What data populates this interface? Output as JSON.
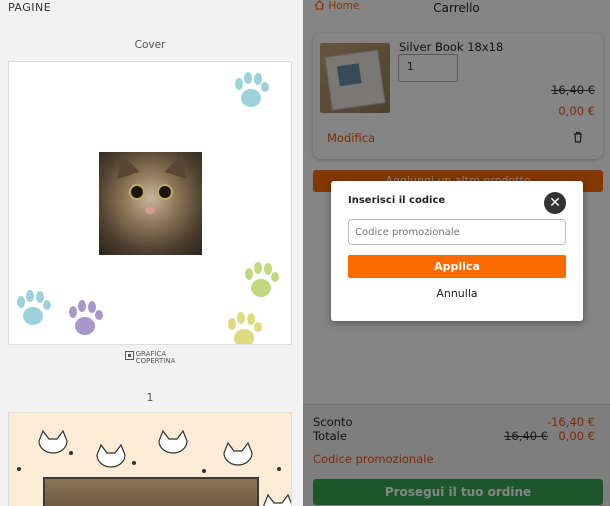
{
  "left": {
    "title": "PAGINE",
    "cover_label": "Cover",
    "grafica_line1": "GRAFICA",
    "grafica_line2": "COPERTINA",
    "page_number": "1"
  },
  "header": {
    "home_label": "Home",
    "title": "Carrello"
  },
  "product": {
    "name": "Silver Book 18x18",
    "quantity": "1",
    "old_price": "16,40 €",
    "new_price": "0,00 €",
    "edit_label": "Modifica"
  },
  "add_button_label": "Aggiungi un altro prodotto",
  "summary": {
    "discount_label": "Sconto",
    "discount_value": "-16,40 €",
    "total_label": "Totale",
    "total_old": "16,40 €",
    "total_new": "0,00 €",
    "promo_link": "Codice promozionale",
    "continue_label": "Prosegui il tuo ordine"
  },
  "modal": {
    "title": "Inserisci il codice",
    "input_placeholder": "Codice promozionale",
    "apply_label": "Applica",
    "cancel_label": "Annulla"
  },
  "colors": {
    "accent_orange": "#ff6a00",
    "price_orange": "#e8540c",
    "continue_green": "#34a853"
  }
}
